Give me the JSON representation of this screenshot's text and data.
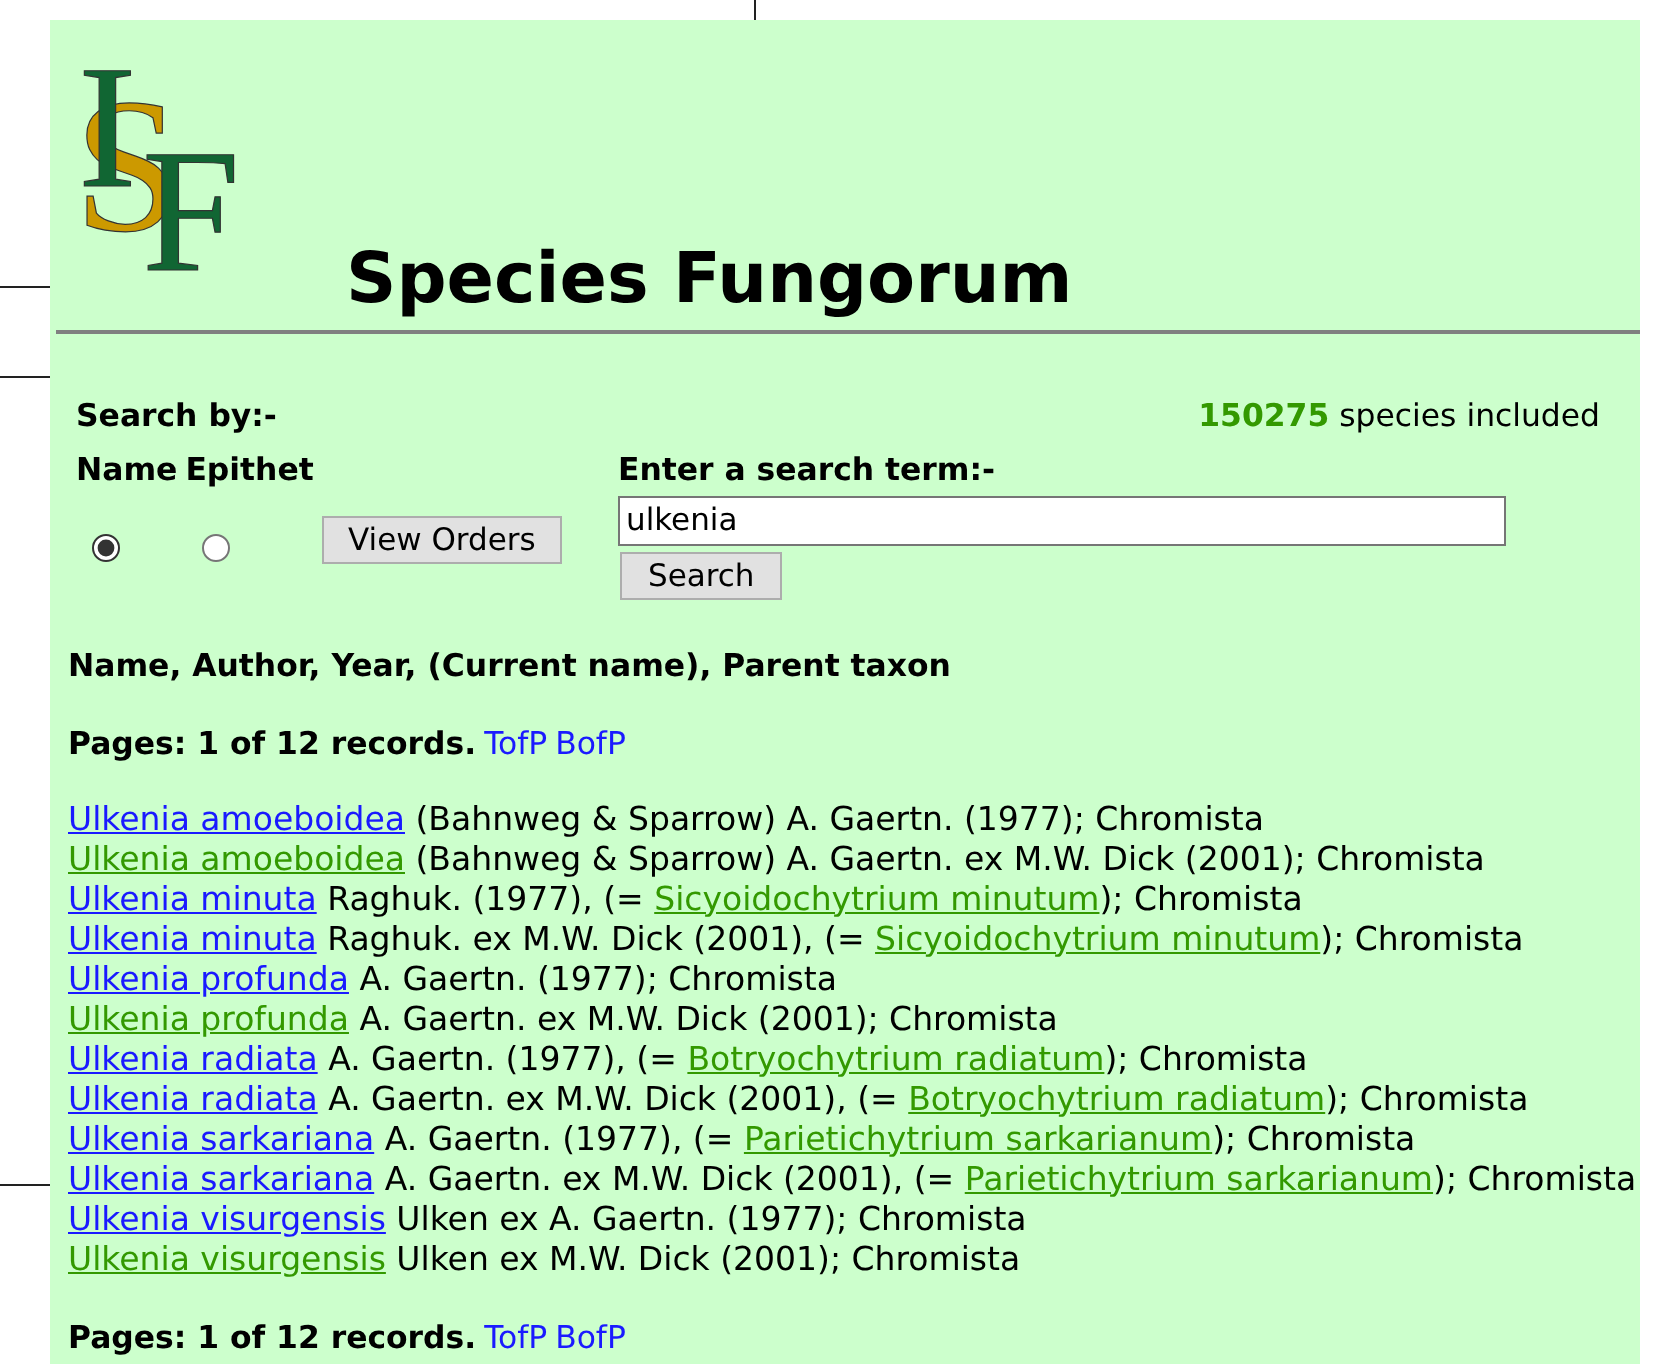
{
  "logo": {
    "letters": [
      "I",
      "S",
      "F"
    ]
  },
  "title": "Species Fungorum",
  "search": {
    "by_label": "Search by:-",
    "count": "150275",
    "count_label": "species included",
    "options": [
      {
        "label": "Name",
        "selected": true
      },
      {
        "label": "Epithet",
        "selected": false
      }
    ],
    "view_orders_button": "View Orders",
    "term_label": "Enter a search term:-",
    "value": "ulkenia",
    "search_button": "Search"
  },
  "results_header": "Name, Author, Year, (Current name), Parent taxon",
  "pages_top": {
    "text": "Pages: 1 of 12 records.",
    "links": [
      "TofP",
      "BofP"
    ]
  },
  "records": [
    {
      "name": "Ulkenia amoeboidea",
      "current": false,
      "authority": "(Bahnweg & Sparrow) A. Gaertn. (1977); Chromista"
    },
    {
      "name": "Ulkenia amoeboidea",
      "current": true,
      "authority": "(Bahnweg & Sparrow) A. Gaertn. ex M.W. Dick (2001); Chromista"
    },
    {
      "name": "Ulkenia minuta",
      "current": false,
      "authority": "Raghuk. (1977), (=",
      "current_name": "Sicyoidochytrium minutum",
      "suffix": "); Chromista"
    },
    {
      "name": "Ulkenia minuta",
      "current": false,
      "authority": "Raghuk. ex M.W. Dick (2001), (=",
      "current_name": "Sicyoidochytrium minutum",
      "suffix": "); Chromista"
    },
    {
      "name": "Ulkenia profunda",
      "current": false,
      "authority": "A. Gaertn. (1977); Chromista"
    },
    {
      "name": "Ulkenia profunda",
      "current": true,
      "authority": "A. Gaertn. ex M.W. Dick (2001); Chromista"
    },
    {
      "name": "Ulkenia radiata",
      "current": false,
      "authority": "A. Gaertn. (1977), (=",
      "current_name": "Botryochytrium radiatum",
      "suffix": "); Chromista"
    },
    {
      "name": "Ulkenia radiata",
      "current": false,
      "authority": "A. Gaertn. ex M.W. Dick (2001), (=",
      "current_name": "Botryochytrium radiatum",
      "suffix": "); Chromista"
    },
    {
      "name": "Ulkenia sarkariana",
      "current": false,
      "authority": "A. Gaertn. (1977), (=",
      "current_name": "Parietichytrium sarkarianum",
      "suffix": "); Chromista"
    },
    {
      "name": "Ulkenia sarkariana",
      "current": false,
      "authority": "A. Gaertn. ex M.W. Dick (2001), (=",
      "current_name": "Parietichytrium sarkarianum",
      "suffix": "); Chromista"
    },
    {
      "name": "Ulkenia visurgensis",
      "current": false,
      "authority": "Ulken ex A. Gaertn. (1977); Chromista"
    },
    {
      "name": "Ulkenia visurgensis",
      "current": true,
      "authority": "Ulken ex M.W. Dick (2001); Chromista"
    }
  ],
  "pages_bottom": {
    "text": "Pages: 1 of 12 records.",
    "links": [
      "TofP",
      "BofP"
    ]
  }
}
